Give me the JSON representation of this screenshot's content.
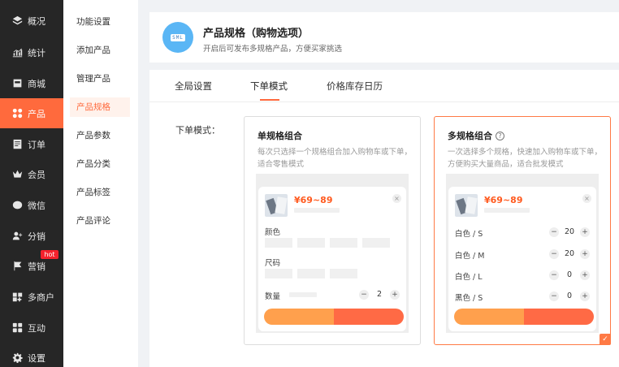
{
  "nav": {
    "items": [
      {
        "label": "概况",
        "icon": "layers-icon"
      },
      {
        "label": "统计",
        "icon": "chart-icon"
      },
      {
        "label": "商城",
        "icon": "store-icon"
      },
      {
        "label": "产品",
        "icon": "grid-icon"
      },
      {
        "label": "订单",
        "icon": "order-icon"
      },
      {
        "label": "会员",
        "icon": "crown-icon"
      },
      {
        "label": "微信",
        "icon": "wechat-icon"
      },
      {
        "label": "分销",
        "icon": "user-share-icon"
      },
      {
        "label": "营销",
        "icon": "flag-icon"
      },
      {
        "label": "多商户",
        "icon": "shop-icon"
      },
      {
        "label": "互动",
        "icon": "apps-icon"
      },
      {
        "label": "设置",
        "icon": "gear-icon"
      }
    ],
    "active_index": 3,
    "hot_badge": "hot"
  },
  "submenu": {
    "items": [
      "功能设置",
      "添加产品",
      "管理产品",
      "产品规格",
      "产品参数",
      "产品分类",
      "产品标签",
      "产品评论"
    ],
    "active_index": 3
  },
  "header": {
    "icon_text": "SML",
    "title": "产品规格（购物选项）",
    "subtitle": "开启后可发布多规格产品，方便买家挑选"
  },
  "tabs": {
    "items": [
      "全局设置",
      "下单模式",
      "价格库存日历"
    ],
    "active_index": 1
  },
  "order_mode": {
    "label": "下单模式：",
    "single": {
      "title": "单规格组合",
      "desc": "每次只选择一个规格组合加入购物车或下单，适合零售模式",
      "price": "¥69~89",
      "attr_color": "颜色",
      "attr_size": "尺码",
      "qty_label": "数量",
      "qty": "2"
    },
    "multi": {
      "title": "多规格组合",
      "help_icon": "question-icon",
      "desc": "一次选择多个规格，快速加入购物车或下单，方便购买大量商品，适合批发模式",
      "price": "¥69~89",
      "rows": [
        {
          "label": "白色 / S",
          "qty": "20"
        },
        {
          "label": "白色 / M",
          "qty": "20"
        },
        {
          "label": "白色 / L",
          "qty": "0"
        },
        {
          "label": "黑色 / S",
          "qty": "0"
        }
      ],
      "selected": true
    }
  },
  "colors": {
    "accent": "#ff6a3d",
    "sidebar_bg": "#262626",
    "button_left": "#ffa04d",
    "button_right": "#ff6a45"
  }
}
